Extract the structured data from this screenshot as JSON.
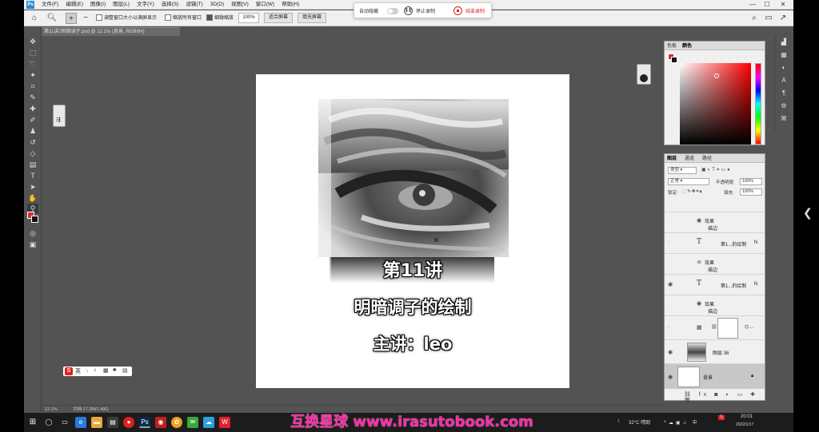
{
  "app": {
    "menu": [
      "文件(F)",
      "编辑(E)",
      "图像(I)",
      "图层(L)",
      "文字(Y)",
      "选择(S)",
      "滤镜(T)",
      "3D(D)",
      "视图(V)",
      "窗口(W)",
      "帮助(H)"
    ],
    "window_controls": {
      "minimize": "—",
      "maximize": "☐",
      "close": "✕"
    }
  },
  "options_bar": {
    "resize_window_label": "调整窗口大小以满屏显示",
    "zoom_all_label": "缩放所有窗口",
    "scrubby_zoom_label": "细微缩放",
    "zoom_value": "100%",
    "fit_screen_label": "适合屏幕",
    "fill_screen_label": "填充屏幕"
  },
  "popup": {
    "auto_hide_label": "自动隐藏",
    "pause_label": "停止录制",
    "stop_label": "结束录制"
  },
  "document": {
    "tab_title": "第11讲2明暗调子.psd @ 12.1% (背景, RGB/8#)"
  },
  "canvas": {
    "line1": "第11讲",
    "line2": "明暗调子的绘制",
    "line3": "主讲：leo"
  },
  "status": {
    "zoom": "12.1%",
    "doc_info": "文档:17.2M/1.49G"
  },
  "color_panel": {
    "tabs": [
      "色板",
      "颜色"
    ],
    "fg_color": "#d0303a",
    "bg_color": "#111111"
  },
  "layers_panel": {
    "tabs": [
      "图层",
      "通道",
      "路径"
    ],
    "kind_filter": "类型",
    "blend_mode": "正常",
    "opacity_label": "不透明度:",
    "opacity_value": "100%",
    "lock_label": "锁定:",
    "fill_label": "填充:",
    "fill_value": "100%",
    "layers": [
      {
        "name": "效果",
        "sub": "描边",
        "type": "effect"
      },
      {
        "name": "第1...的绘制",
        "type": "text",
        "visible": false
      },
      {
        "name": "效果",
        "sub": "描边",
        "type": "effect"
      },
      {
        "name": "第1...的绘制",
        "type": "text",
        "visible": true
      },
      {
        "name": "效果",
        "sub": "描边",
        "type": "effect"
      },
      {
        "name": "",
        "type": "adjust",
        "visible": false
      },
      {
        "name": "图层 36",
        "type": "image",
        "visible": true
      },
      {
        "name": "背景",
        "type": "background",
        "visible": true
      }
    ]
  },
  "taskbar": {
    "watermark": "互换星球 www.irasutobook.com",
    "weather": "32°C 晴朗",
    "time": "20:01",
    "date": "2022/1/17"
  }
}
